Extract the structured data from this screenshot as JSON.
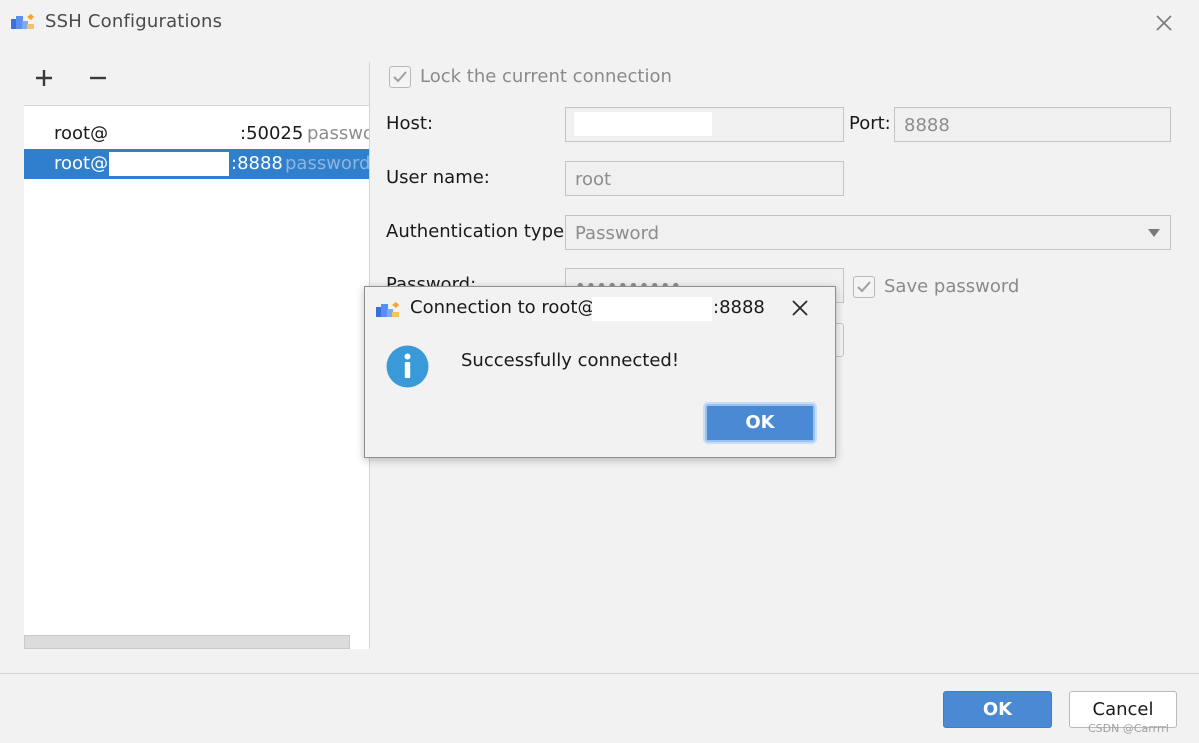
{
  "window": {
    "title": "SSH Configurations"
  },
  "toolbar": {
    "add_icon": "plus-icon",
    "remove_icon": "minus-icon"
  },
  "connections": [
    {
      "user": "root@",
      "port": ":50025",
      "auth": "passwo"
    },
    {
      "user": "root@",
      "port": ":8888",
      "auth": "password"
    }
  ],
  "form": {
    "lock_label": "Lock the current connection",
    "lock_checked": true,
    "host_label": "Host:",
    "port_label": "Port:",
    "port_value": "8888",
    "username_label": "User name:",
    "username_value": "root",
    "auth_label": "Authentication type:",
    "auth_value": "Password",
    "password_label": "Password:",
    "password_value": "••••••••••",
    "save_password_label": "Save password",
    "save_password_checked": true
  },
  "footer": {
    "ok_label": "OK",
    "cancel_label": "Cancel",
    "watermark": "CSDN @Carrrrl"
  },
  "dialog": {
    "title_prefix": "Connection to root@",
    "title_port": ":8888",
    "message": "Successfully connected!",
    "ok_label": "OK",
    "icon": "info-icon"
  },
  "colors": {
    "selection": "#2f7fcc",
    "primary_button": "#4a8ad4",
    "info_icon": "#3a9ad9"
  }
}
